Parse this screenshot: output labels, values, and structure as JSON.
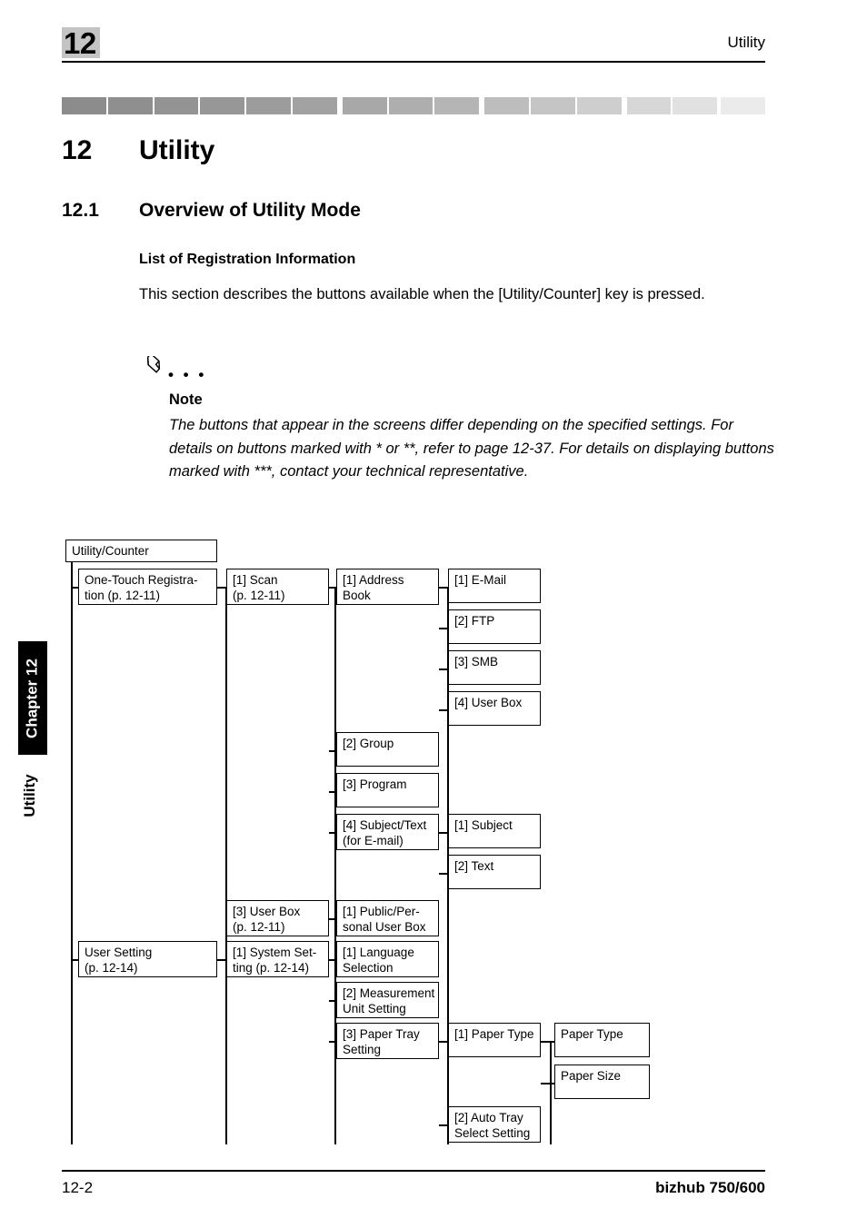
{
  "header": {
    "chapter_number": "12",
    "running_title": "Utility"
  },
  "titles": {
    "chapter_num": "12",
    "chapter_text": "Utility",
    "section_num": "12.1",
    "section_text": "Overview of Utility Mode",
    "subsection": "List of Registration Information",
    "intro": "This section describes the buttons available when the [Utility/Counter] key is pressed."
  },
  "note": {
    "icon": "pencil-icon",
    "dots": "• • •",
    "label": "Note",
    "body": "The buttons that appear in the screens differ depending on the specified settings. For details on buttons marked with * or **, refer to page 12-37. For details on displaying buttons marked with ***, contact your technical representative."
  },
  "side_tab": {
    "chapter_label": "Chapter 12",
    "section_label": "Utility"
  },
  "footer": {
    "page_number": "12-2",
    "product_name": "bizhub 750/600"
  },
  "gradient_bar": {
    "segments": [
      "#8c8c8c",
      "#8f8f8f",
      "#939393",
      "#979797",
      "#9c9c9c",
      "#a2a2a2",
      "#a8a8a8",
      "#aeaeae",
      "#b5b5b5",
      "#bdbdbd",
      "#c5c5c5",
      "#cecece",
      "#d7d7d7",
      "#e1e1e1",
      "#ebebeb"
    ]
  },
  "tree": {
    "nodes": [
      {
        "id": "utility-counter",
        "label": "Utility/Counter"
      },
      {
        "id": "one-touch-registration",
        "label": "One-Touch Registra-\ntion (p. 12-11)"
      },
      {
        "id": "scan",
        "label": "[1] Scan\n(p. 12-11)"
      },
      {
        "id": "address-book",
        "label": "[1] Address\nBook"
      },
      {
        "id": "email",
        "label": "[1] E-Mail"
      },
      {
        "id": "ftp",
        "label": "[2] FTP"
      },
      {
        "id": "smb",
        "label": "[3] SMB"
      },
      {
        "id": "user-box-dest",
        "label": "[4] User Box"
      },
      {
        "id": "group",
        "label": "[2] Group"
      },
      {
        "id": "program",
        "label": "[3] Program"
      },
      {
        "id": "subject-text",
        "label": "[4] Subject/Text\n(for E-mail)"
      },
      {
        "id": "subject",
        "label": "[1] Subject"
      },
      {
        "id": "text",
        "label": "[2] Text"
      },
      {
        "id": "user-box",
        "label": "[3] User Box\n(p. 12-11)"
      },
      {
        "id": "public-personal-user-box",
        "label": "[1] Public/Per-\nsonal User Box"
      },
      {
        "id": "user-setting",
        "label": "User Setting\n(p. 12-14)"
      },
      {
        "id": "system-setting",
        "label": "[1] System Set-\nting (p. 12-14)"
      },
      {
        "id": "language-selection",
        "label": "[1] Language\nSelection"
      },
      {
        "id": "measurement-unit-setting",
        "label": "[2] Measurement\nUnit Setting"
      },
      {
        "id": "paper-tray-setting",
        "label": "[3] Paper Tray\nSetting"
      },
      {
        "id": "paper-type-1",
        "label": "[1] Paper Type"
      },
      {
        "id": "paper-type-leaf",
        "label": "Paper Type"
      },
      {
        "id": "paper-size-leaf",
        "label": "Paper Size"
      },
      {
        "id": "auto-tray-select-setting",
        "label": "[2] Auto Tray\nSelect Setting"
      }
    ]
  }
}
